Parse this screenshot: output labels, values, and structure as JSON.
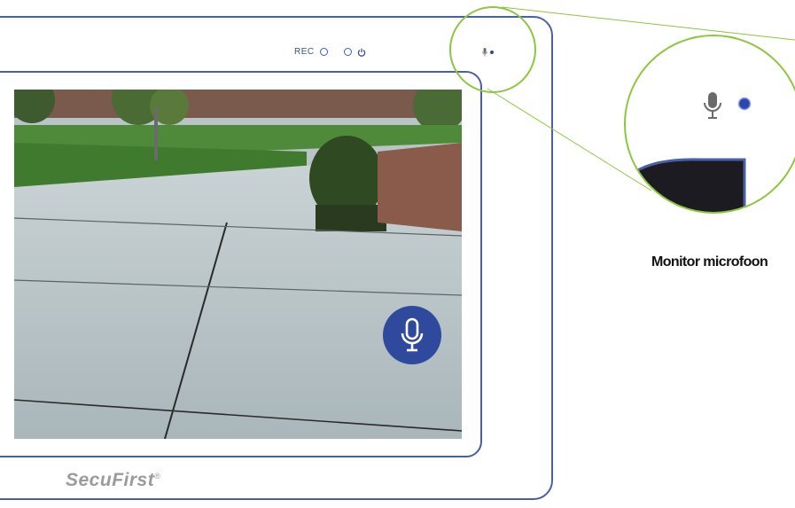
{
  "status_bar": {
    "rec_label": "REC",
    "led_indicator_icon": "ring-led-icon",
    "power_icon": "power-icon"
  },
  "mic_status": {
    "icon": "microphone-icon",
    "indicator": "mic-active-dot"
  },
  "speak_button": {
    "icon": "microphone-icon",
    "color": "#2f4a9c"
  },
  "brand": {
    "name": "SecuFirst",
    "mark": "®"
  },
  "callout": {
    "caption": "Monitor microfoon",
    "icon": "microphone-icon",
    "indicator_color": "#2d46b0",
    "outline_color": "#8dc63f"
  },
  "colors": {
    "frame": "#4a5fa8",
    "accent": "#2f4a9c"
  }
}
